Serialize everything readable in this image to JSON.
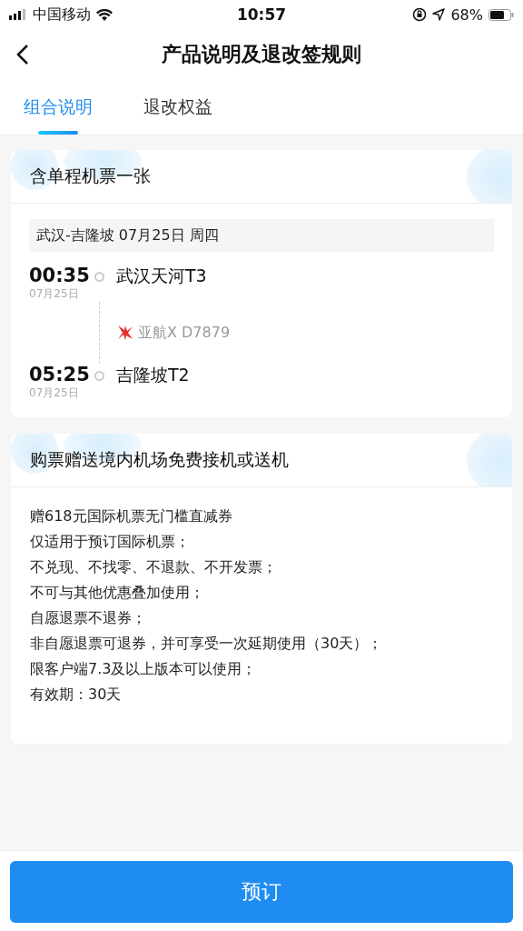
{
  "status_bar": {
    "carrier": "中国移动",
    "time": "10:57",
    "battery": "68%"
  },
  "nav": {
    "title": "产品说明及退改签规则"
  },
  "tabs": [
    {
      "label": "组合说明",
      "selected": true
    },
    {
      "label": "退改权益",
      "selected": false
    }
  ],
  "ticket_card": {
    "title": "含单程机票一张",
    "route": "武汉-吉隆坡 07月25日 周四",
    "departure": {
      "time": "00:35",
      "date": "07月25日",
      "airport": "武汉天河T3"
    },
    "flight": "亚航X D7879",
    "arrival": {
      "time": "05:25",
      "date": "07月25日",
      "airport": "吉隆坡T2"
    }
  },
  "gift_card": {
    "title": "购票赠送境内机场免费接机或送机",
    "lines": [
      "赠618元国际机票无门槛直减券",
      "仅适用于预订国际机票；",
      "不兑现、不找零、不退款、不开发票；",
      "不可与其他优惠叠加使用；",
      "自愿退票不退券；",
      "非自愿退票可退券，并可享受一次延期使用（30天）；",
      "限客户端7.3及以上版本可以使用；",
      "有效期：30天"
    ]
  },
  "book_button": "预订"
}
